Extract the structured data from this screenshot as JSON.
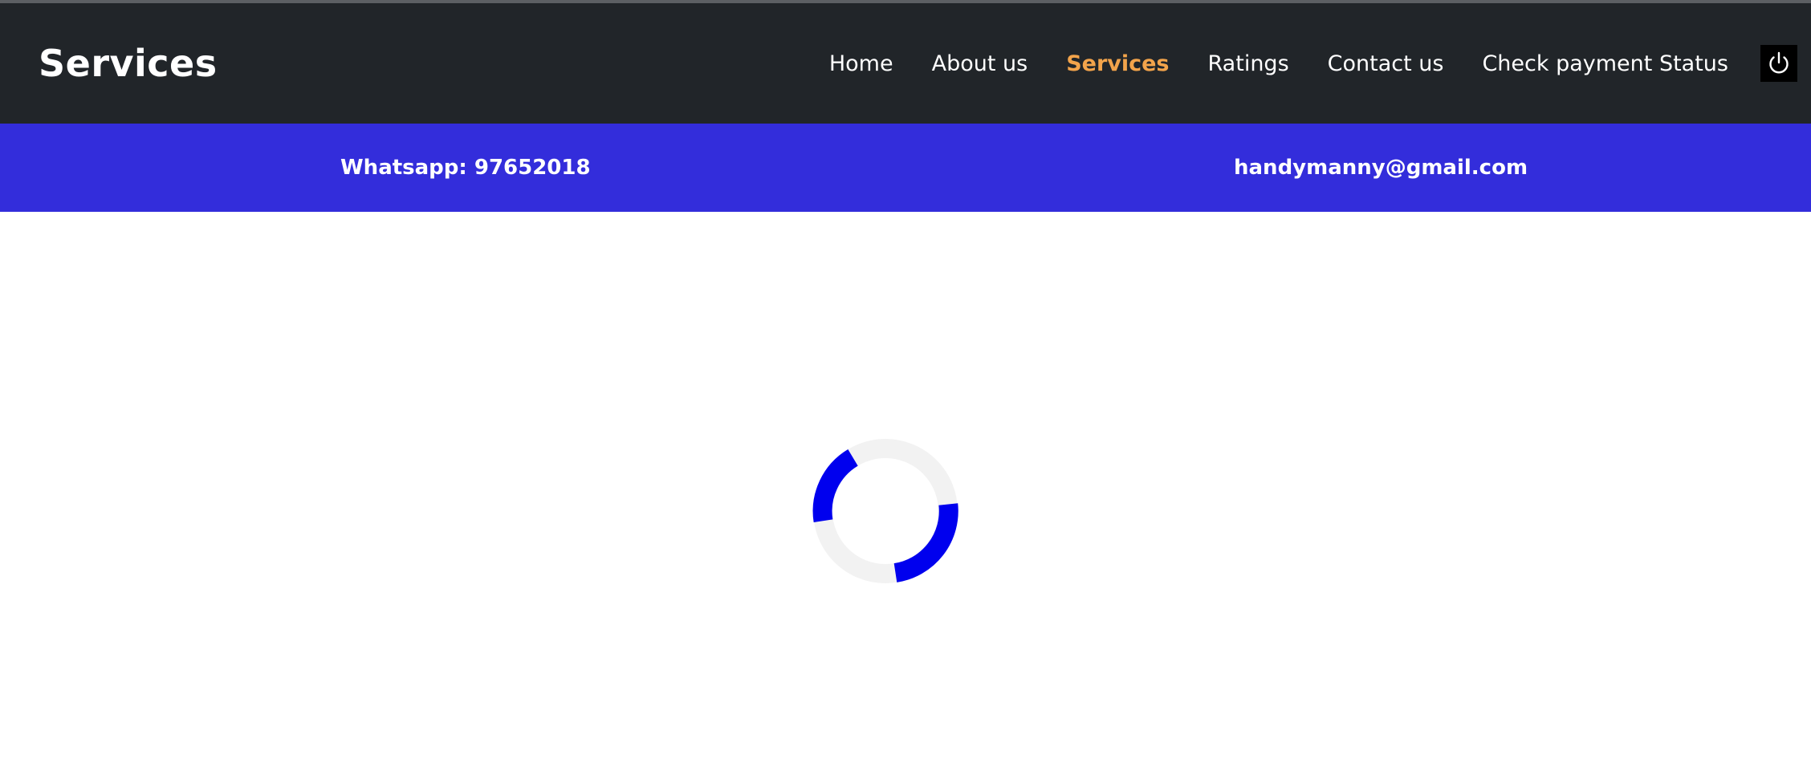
{
  "header": {
    "title": "Services",
    "nav": [
      {
        "label": "Home",
        "active": false
      },
      {
        "label": "About us",
        "active": false
      },
      {
        "label": "Services",
        "active": true
      },
      {
        "label": "Ratings",
        "active": false
      },
      {
        "label": "Contact us",
        "active": false
      },
      {
        "label": "Check payment Status",
        "active": false
      }
    ],
    "power_icon": "power-icon"
  },
  "contact_bar": {
    "whatsapp": "Whatsapp: 97652018",
    "email": "handymanny@gmail.com"
  },
  "loader": {
    "icon": "loading-spinner-icon",
    "accent": "#0000ee",
    "track": "#f2f2f2"
  },
  "colors": {
    "navbar_bg": "#212529",
    "nav_active": "#f3a44b",
    "contact_bar_bg": "#332ddb"
  }
}
